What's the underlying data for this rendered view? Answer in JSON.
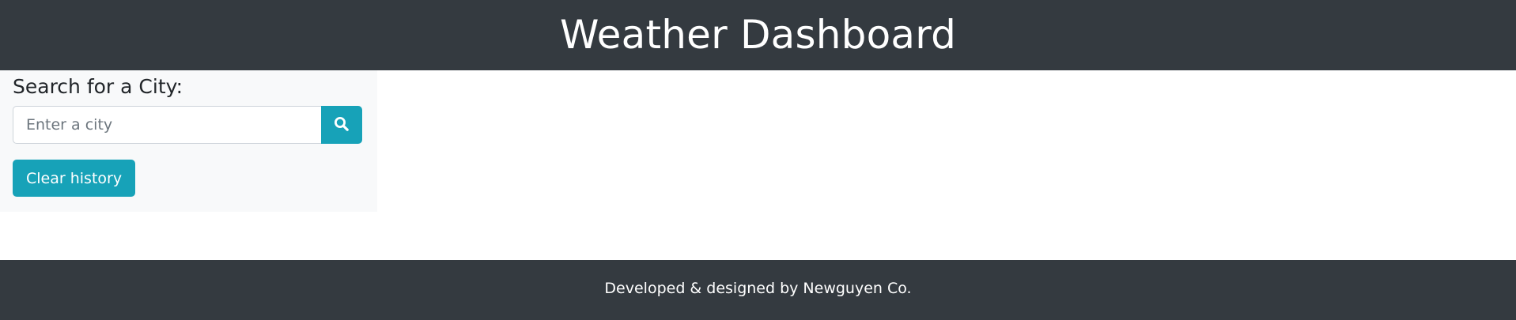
{
  "header": {
    "title": "Weather Dashboard"
  },
  "sidebar": {
    "search_label": "Search for a City:",
    "search_input": {
      "placeholder": "Enter a city",
      "value": ""
    },
    "search_button_icon": "search-icon",
    "clear_button_label": "Clear history"
  },
  "footer": {
    "text": "Developed & designed by Newguyen Co."
  },
  "colors": {
    "dark_bar": "#343a40",
    "sidebar_bg": "#f8f9fa",
    "accent": "#17a2b8"
  }
}
